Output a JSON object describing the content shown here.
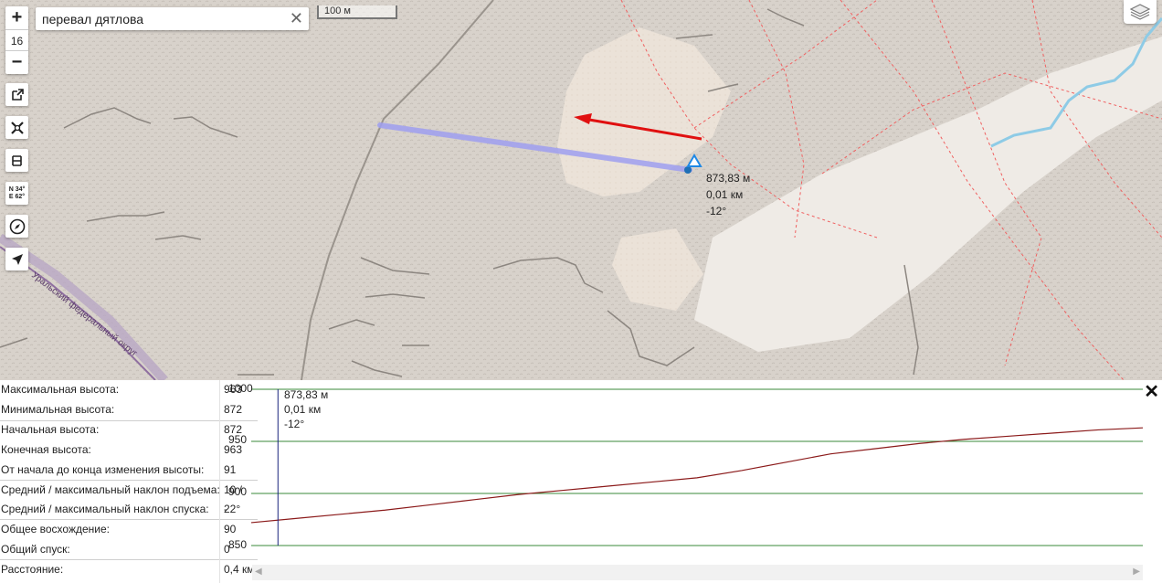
{
  "search": {
    "value": "перевал дятлова",
    "placeholder": ""
  },
  "zoom": {
    "plus": "+",
    "level": "16",
    "minus": "−"
  },
  "scale_bar": {
    "label": "100 м"
  },
  "coords_button": {
    "line1": "N 34°",
    "line2": "E 62°"
  },
  "map_labels": {
    "boundary": "Уральский федеральный округ"
  },
  "point_info": {
    "elevation": "873,83 м",
    "distance": "0,01 км",
    "slope": "-12°"
  },
  "stats": [
    {
      "label": "Максимальная высота:",
      "value": "963"
    },
    {
      "label": "Минимальная высота:",
      "value": "872"
    },
    {
      "label": "Начальная высота:",
      "value": "872"
    },
    {
      "label": "Конечная высота:",
      "value": "963"
    },
    {
      "label": "От начала до конца изменения высоты:",
      "value": "91"
    },
    {
      "label": "Средний / максимальный наклон подъема:",
      "value": "10 / 22°"
    },
    {
      "label": "Средний / максимальный наклон спуска:",
      "value": "-"
    },
    {
      "label": "Общее восхождение:",
      "value": "90"
    },
    {
      "label": "Общий спуск:",
      "value": "0"
    },
    {
      "label": "Расстояние:",
      "value": "0,4 км"
    }
  ],
  "profile": {
    "yticks": [
      "1000",
      "950",
      "900",
      "850"
    ],
    "cursor_label": {
      "elevation": "873,83 м",
      "distance": "0,01 км",
      "slope": "-12°"
    }
  },
  "chart_data": {
    "type": "line",
    "ylim": [
      850,
      1000
    ],
    "yticks": [
      1000,
      950,
      900,
      850
    ],
    "x": [
      0,
      0.05,
      0.1,
      0.15,
      0.2,
      0.25,
      0.3,
      0.35,
      0.4,
      0.45,
      0.5,
      0.55,
      0.6,
      0.65,
      0.7,
      0.75,
      0.8,
      0.85,
      0.9,
      0.95,
      1.0
    ],
    "series": [
      {
        "values": [
          872,
          876,
          880,
          884,
          889,
          894,
          899,
          903,
          907,
          911,
          915,
          922,
          930,
          938,
          943,
          948,
          952,
          955,
          958,
          961,
          963
        ]
      }
    ],
    "cursor_x": 0.03,
    "colors": {
      "line": "#8b1a1a",
      "cursor": "#1a237e",
      "grid": "#3a8a3a"
    }
  },
  "colors": {
    "route": "#9f9ff0",
    "arrow": "#e01010",
    "water": "#8ecbe6",
    "trail": "#f06060",
    "marker": "#1e88e5"
  }
}
